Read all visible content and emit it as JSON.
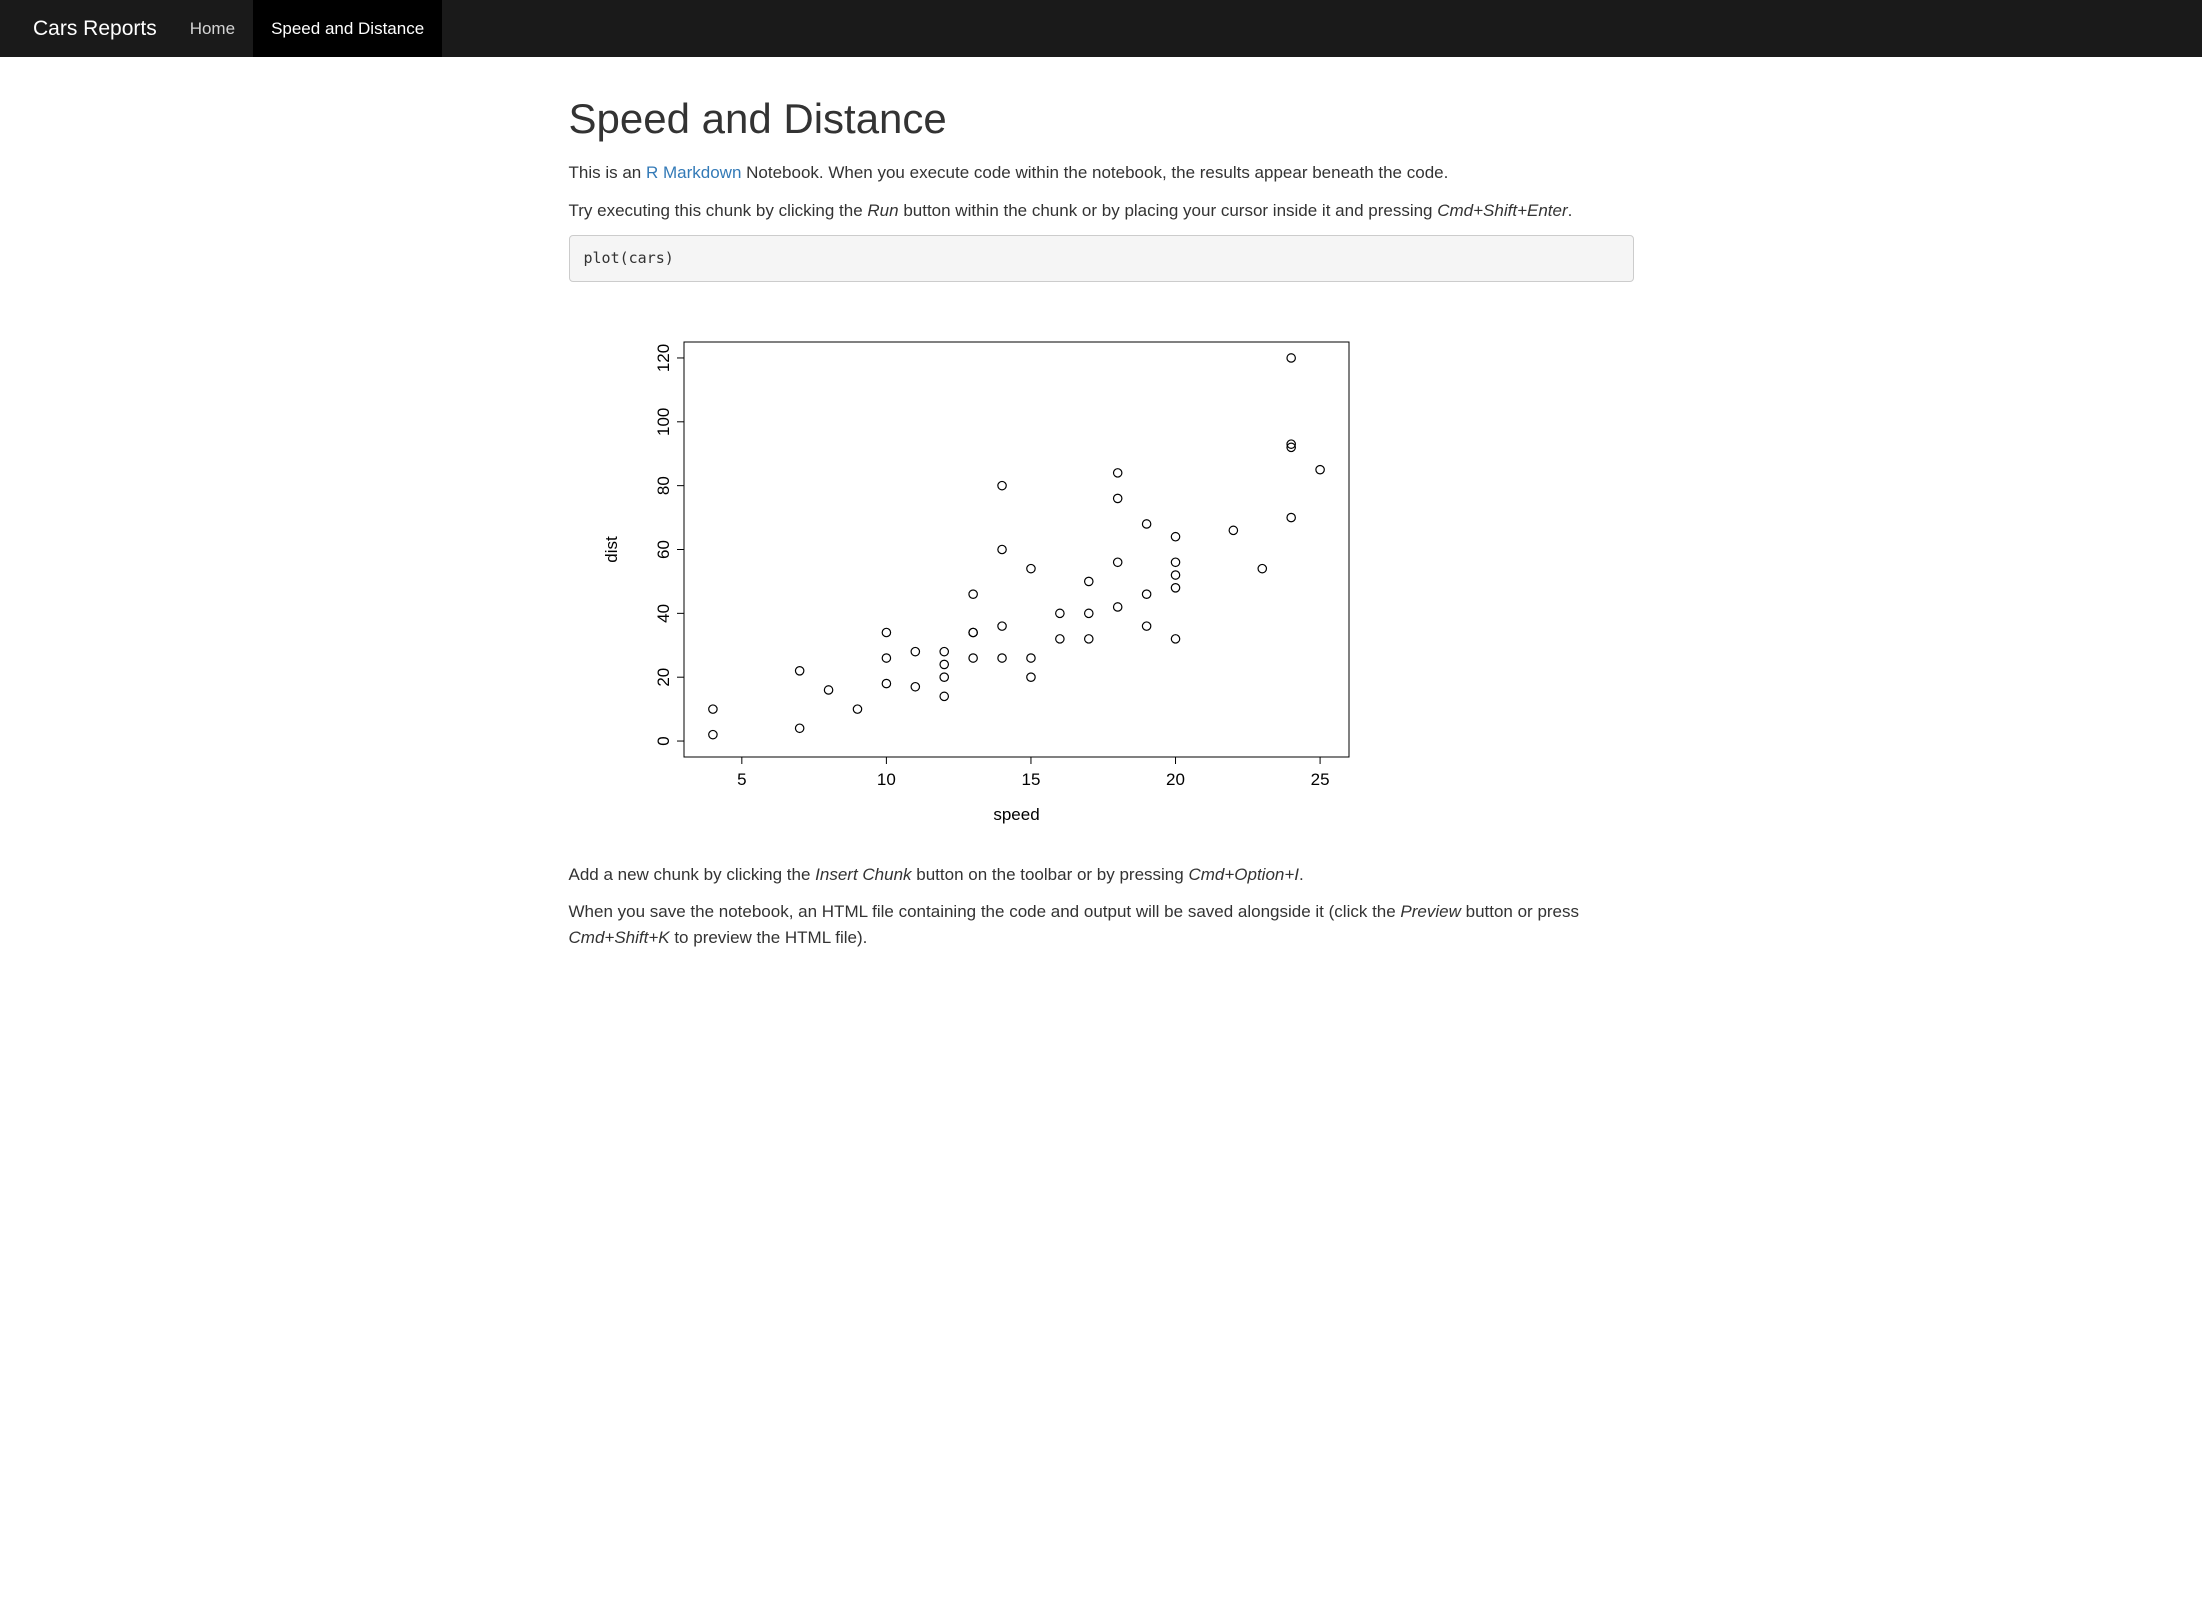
{
  "navbar": {
    "brand": "Cars Reports",
    "items": [
      {
        "label": "Home",
        "active": false
      },
      {
        "label": "Speed and Distance",
        "active": true
      }
    ]
  },
  "page": {
    "title": "Speed and Distance",
    "intro_prefix": "This is an ",
    "intro_link": "R Markdown",
    "intro_suffix": " Notebook. When you execute code within the notebook, the results appear beneath the code.",
    "try_prefix": "Try executing this chunk by clicking the ",
    "try_run": "Run",
    "try_mid": " button within the chunk or by placing your cursor inside it and pressing ",
    "try_shortcut": "Cmd+Shift+Enter",
    "try_suffix": ".",
    "code": "plot(cars)",
    "add_prefix": "Add a new chunk by clicking the ",
    "add_insert": "Insert Chunk",
    "add_mid": " button on the toolbar or by pressing ",
    "add_shortcut": "Cmd+Option+I",
    "add_suffix": ".",
    "save_prefix": "When you save the notebook, an HTML file containing the code and output will be saved alongside it (click the ",
    "save_preview": "Preview",
    "save_mid": " button or press ",
    "save_shortcut": "Cmd+Shift+K",
    "save_suffix": " to preview the HTML file)."
  },
  "chart_data": {
    "type": "scatter",
    "xlabel": "speed",
    "ylabel": "dist",
    "xlim": [
      3,
      26
    ],
    "ylim": [
      -5,
      125
    ],
    "x_ticks": [
      5,
      10,
      15,
      20,
      25
    ],
    "y_ticks": [
      0,
      20,
      40,
      60,
      80,
      100,
      120
    ],
    "points": [
      [
        4,
        2
      ],
      [
        4,
        10
      ],
      [
        7,
        4
      ],
      [
        7,
        22
      ],
      [
        8,
        16
      ],
      [
        9,
        10
      ],
      [
        10,
        18
      ],
      [
        10,
        26
      ],
      [
        10,
        34
      ],
      [
        11,
        17
      ],
      [
        11,
        28
      ],
      [
        12,
        14
      ],
      [
        12,
        20
      ],
      [
        12,
        24
      ],
      [
        12,
        28
      ],
      [
        13,
        26
      ],
      [
        13,
        34
      ],
      [
        13,
        34
      ],
      [
        13,
        46
      ],
      [
        14,
        26
      ],
      [
        14,
        36
      ],
      [
        14,
        60
      ],
      [
        14,
        80
      ],
      [
        15,
        20
      ],
      [
        15,
        26
      ],
      [
        15,
        54
      ],
      [
        16,
        32
      ],
      [
        16,
        40
      ],
      [
        17,
        32
      ],
      [
        17,
        40
      ],
      [
        17,
        50
      ],
      [
        18,
        42
      ],
      [
        18,
        56
      ],
      [
        18,
        76
      ],
      [
        18,
        84
      ],
      [
        19,
        36
      ],
      [
        19,
        46
      ],
      [
        19,
        68
      ],
      [
        20,
        32
      ],
      [
        20,
        48
      ],
      [
        20,
        52
      ],
      [
        20,
        56
      ],
      [
        20,
        64
      ],
      [
        22,
        66
      ],
      [
        23,
        54
      ],
      [
        24,
        70
      ],
      [
        24,
        92
      ],
      [
        24,
        93
      ],
      [
        24,
        120
      ],
      [
        25,
        85
      ]
    ]
  }
}
